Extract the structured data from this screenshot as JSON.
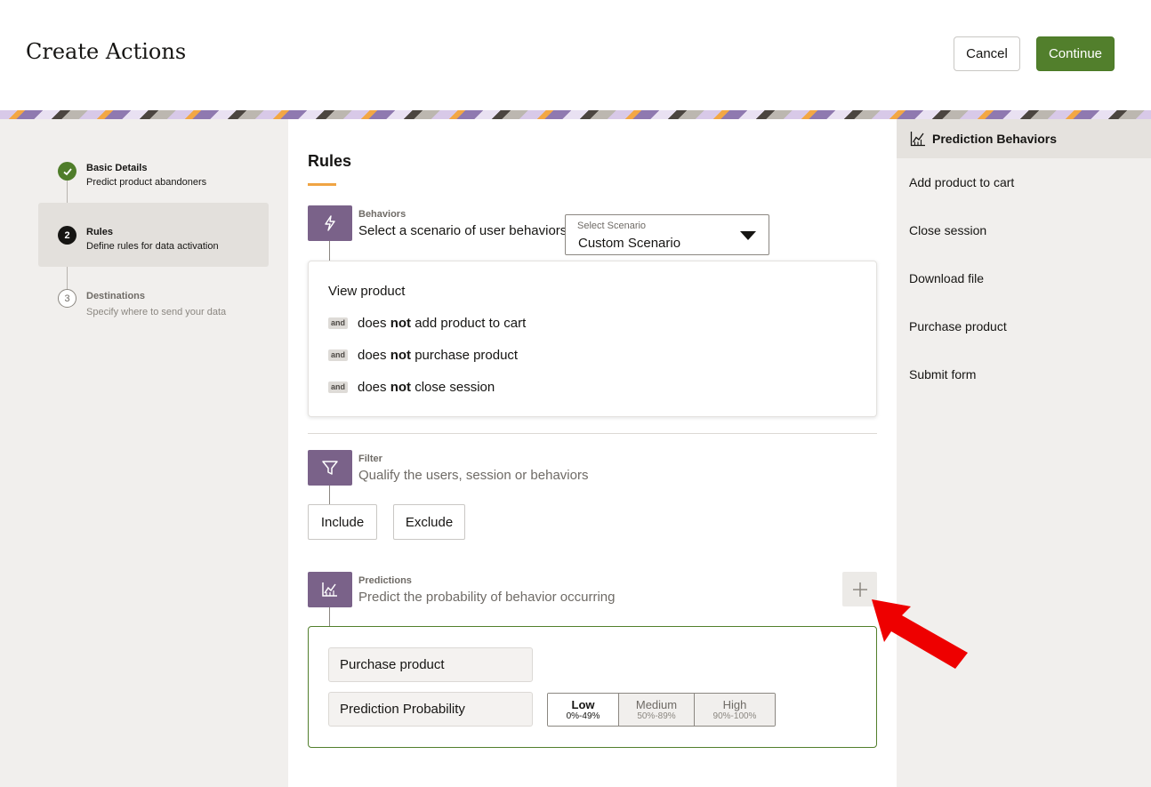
{
  "header": {
    "title": "Create Actions",
    "cancel_label": "Cancel",
    "continue_label": "Continue"
  },
  "stepper": {
    "steps": [
      {
        "title": "Basic Details",
        "subtitle": "Predict product abandoners",
        "status": "done"
      },
      {
        "title": "Rules",
        "number": "2",
        "subtitle": "Define rules for data activation",
        "status": "current"
      },
      {
        "title": "Destinations",
        "number": "3",
        "subtitle": "Specify where to send your data",
        "status": "todo"
      }
    ]
  },
  "main": {
    "title": "Rules",
    "behaviors": {
      "label": "Behaviors",
      "description": "Select a scenario of user behaviors",
      "select_label": "Select Scenario",
      "select_value": "Custom Scenario",
      "first_item": "View product",
      "and_label": "and",
      "rows": [
        {
          "prefix": "does ",
          "bold": "not",
          "suffix": " add product to cart"
        },
        {
          "prefix": "does ",
          "bold": "not",
          "suffix": " purchase product"
        },
        {
          "prefix": "does ",
          "bold": "not",
          "suffix": " close session"
        }
      ]
    },
    "filter": {
      "label": "Filter",
      "description": "Qualify the users, session or behaviors",
      "include_label": "Include",
      "exclude_label": "Exclude"
    },
    "predictions": {
      "label": "Predictions",
      "description": "Predict the probability of behavior occurring",
      "behavior_value": "Purchase product",
      "probability_label": "Prediction Probability",
      "levels": [
        {
          "name": "Low",
          "range": "0%-49%",
          "selected": true
        },
        {
          "name": "Medium",
          "range": "50%-89%",
          "selected": false
        },
        {
          "name": "High",
          "range": "90%-100%",
          "selected": false
        }
      ]
    }
  },
  "right_panel": {
    "title": "Prediction Behaviors",
    "icon": "chart-icon",
    "items": [
      "Add product to cart",
      "Close session",
      "Download file",
      "Purchase product",
      "Submit form"
    ]
  },
  "colors": {
    "accent_green": "#527f2c",
    "section_purple": "#7a6289",
    "underline_orange": "#f0a443",
    "annotation_red": "#ee0000"
  }
}
